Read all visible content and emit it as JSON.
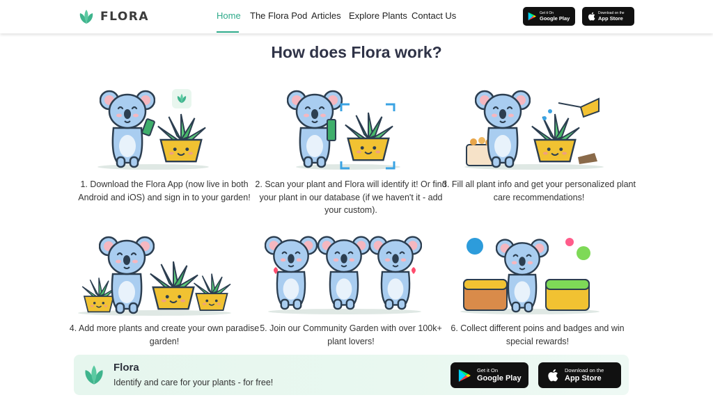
{
  "header": {
    "brand": "FLORA",
    "nav": [
      "Home",
      "The Flora Pod",
      "Articles",
      "Explore Plants",
      "Contact Us"
    ],
    "active_index": 0,
    "google_play": {
      "small": "Get it On",
      "big": "Google Play"
    },
    "app_store": {
      "small": "Download on the",
      "big": "App Store"
    }
  },
  "main": {
    "title": "How does Flora work?",
    "steps": [
      {
        "text": "1. Download the Flora App (now live in both Android and iOS) and sign in to your garden!",
        "illustration": "koala-phone-plant"
      },
      {
        "text": "2. Scan your plant and Flora will identify it! Or find your plant in our database (if we haven't it - add your custom).",
        "illustration": "koala-scan-plant"
      },
      {
        "text": "3. Fill all plant info and get your personalized plant care recommendations!",
        "illustration": "koala-watering-can"
      },
      {
        "text": "4. Add more plants and create your own paradise garden!",
        "illustration": "koala-many-plants"
      },
      {
        "text": "5. Join our Community Garden with over 100k+ plant lovers!",
        "illustration": "three-koalas"
      },
      {
        "text": "6. Collect different poins and badges and win special rewards!",
        "illustration": "koala-treasure-chests"
      }
    ]
  },
  "banner": {
    "title": "Flora",
    "subtitle": "Identify and care for your plants - for free!",
    "google_play": {
      "small": "Get it On",
      "big": "Google Play"
    },
    "app_store": {
      "small": "Download on the",
      "big": "App Store"
    }
  },
  "colors": {
    "accent": "#2eaa8a",
    "koala": "#a9cdf0",
    "pot": "#f1c232",
    "leaf": "#48b86a"
  }
}
